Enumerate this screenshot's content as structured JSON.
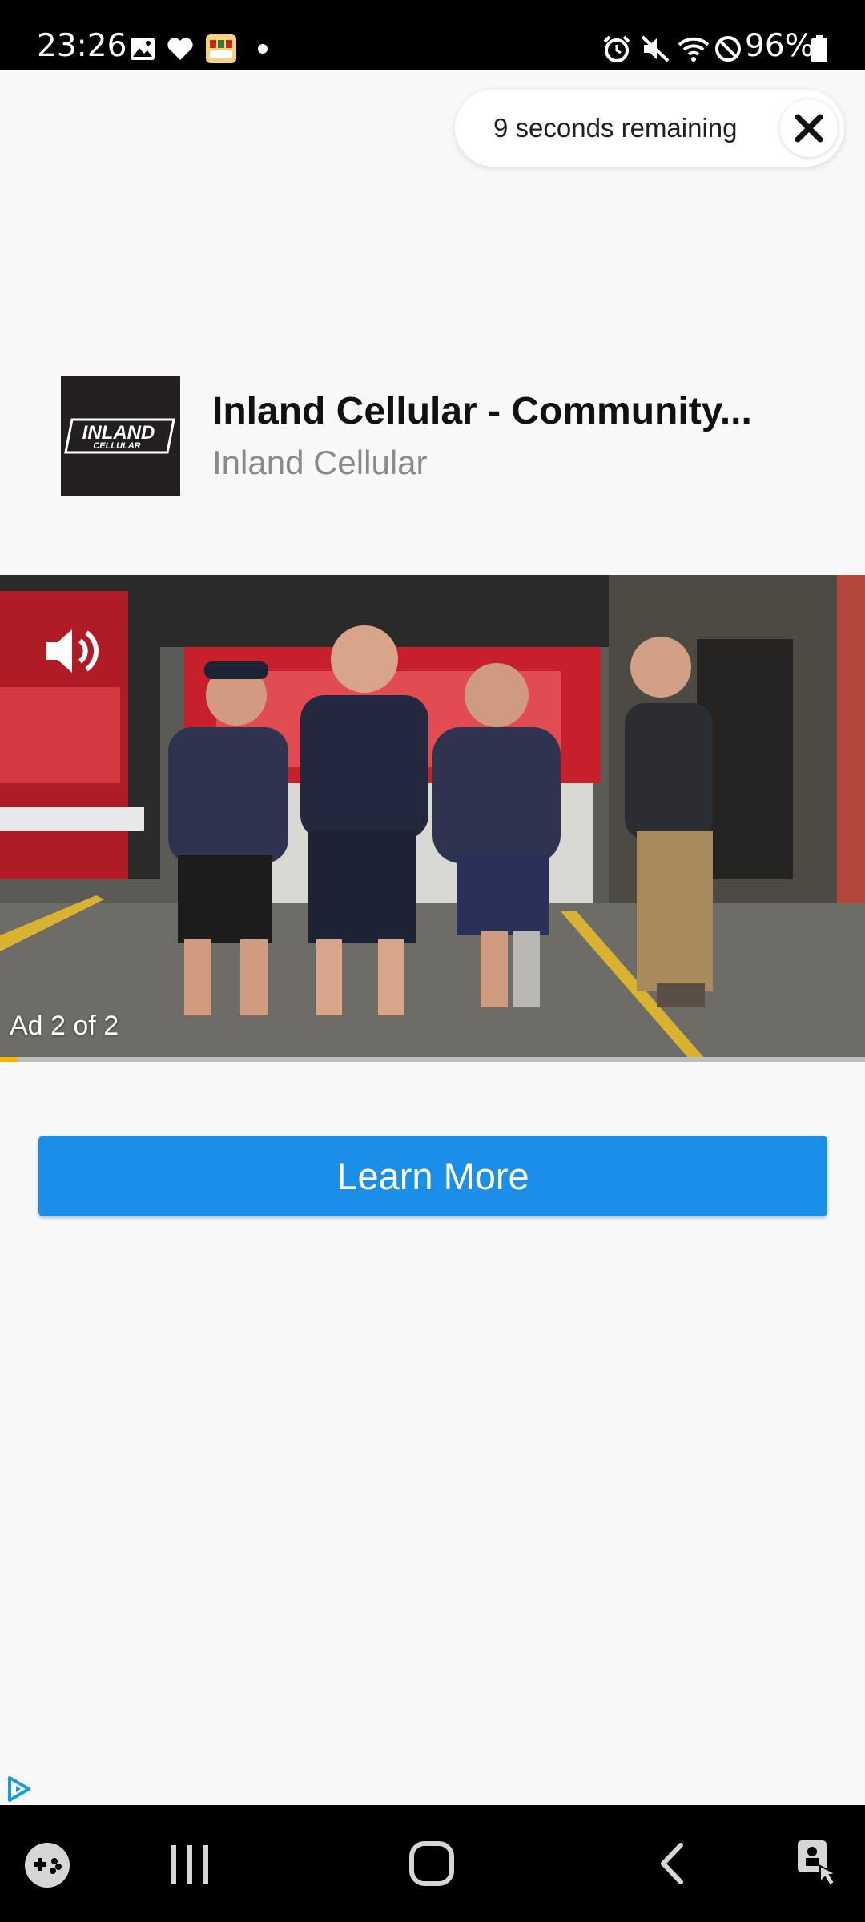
{
  "status_bar": {
    "time": "23:26",
    "battery": "96%",
    "left_icons": [
      "gallery-icon",
      "heart-icon",
      "app-icon",
      "dot-icon"
    ],
    "right_icons": [
      "alarm-icon",
      "mute-icon",
      "wifi-icon",
      "do-not-disturb-icon",
      "battery-icon"
    ]
  },
  "countdown": {
    "text": "9 seconds remaining",
    "close_icon": "close-icon"
  },
  "advertiser": {
    "logo_text_top": "INLAND",
    "logo_text_bottom": "CELLULAR",
    "title": "Inland Cellular - Community...",
    "name": "Inland Cellular"
  },
  "video": {
    "mute_icon": "volume-icon",
    "ad_counter": "Ad 2 of 2",
    "progress": 0.02,
    "progress_color": "#f5b400"
  },
  "cta": {
    "label": "Learn More",
    "color": "#1a8ee9"
  },
  "nav_bar": {
    "icons": [
      "game-launcher-icon",
      "recents-icon",
      "home-icon",
      "back-icon",
      "screen-lock-icon"
    ]
  }
}
